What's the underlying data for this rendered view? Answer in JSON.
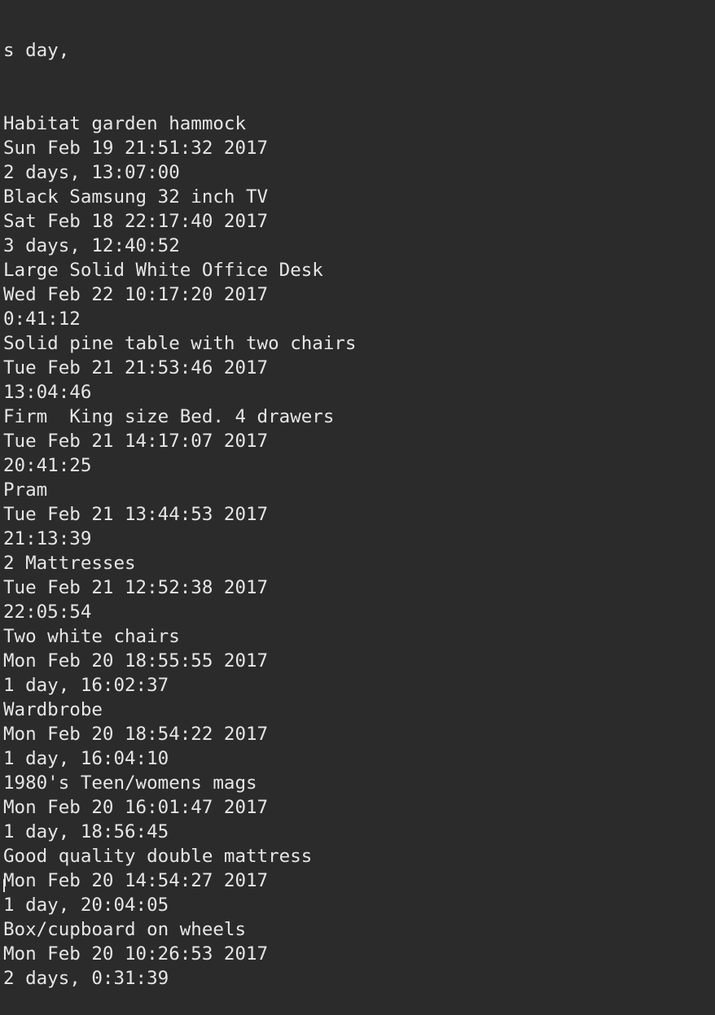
{
  "terminal": {
    "top_partial_line": "s day,",
    "entries": [
      {
        "title": "Habitat garden hammock",
        "date": "Sun Feb 19 21:51:32 2017",
        "elapsed": "2 days, 13:07:00"
      },
      {
        "title": "Black Samsung 32 inch TV",
        "date": "Sat Feb 18 22:17:40 2017",
        "elapsed": "3 days, 12:40:52"
      },
      {
        "title": "Large Solid White Office Desk",
        "date": "Wed Feb 22 10:17:20 2017",
        "elapsed": "0:41:12"
      },
      {
        "title": "Solid pine table with two chairs",
        "date": "Tue Feb 21 21:53:46 2017",
        "elapsed": "13:04:46"
      },
      {
        "title": "Firm  King size Bed. 4 drawers",
        "date": "Tue Feb 21 14:17:07 2017",
        "elapsed": "20:41:25"
      },
      {
        "title": "Pram",
        "date": "Tue Feb 21 13:44:53 2017",
        "elapsed": "21:13:39"
      },
      {
        "title": "2 Mattresses",
        "date": "Tue Feb 21 12:52:38 2017",
        "elapsed": "22:05:54"
      },
      {
        "title": "Two white chairs",
        "date": "Mon Feb 20 18:55:55 2017",
        "elapsed": "1 day, 16:02:37"
      },
      {
        "title": "Wardbrobe",
        "date": "Mon Feb 20 18:54:22 2017",
        "elapsed": "1 day, 16:04:10"
      },
      {
        "title": "1980's Teen/womens mags",
        "date": "Mon Feb 20 16:01:47 2017",
        "elapsed": "1 day, 18:56:45"
      },
      {
        "title": "Good quality double mattress",
        "date": "Mon Feb 20 14:54:27 2017",
        "elapsed": "1 day, 20:04:05"
      },
      {
        "title": "Box/cupboard on wheels",
        "date": "Mon Feb 20 10:26:53 2017",
        "elapsed": "2 days, 0:31:39"
      }
    ]
  },
  "colors": {
    "background": "#2b2b2b",
    "text": "#e6e6e6"
  }
}
